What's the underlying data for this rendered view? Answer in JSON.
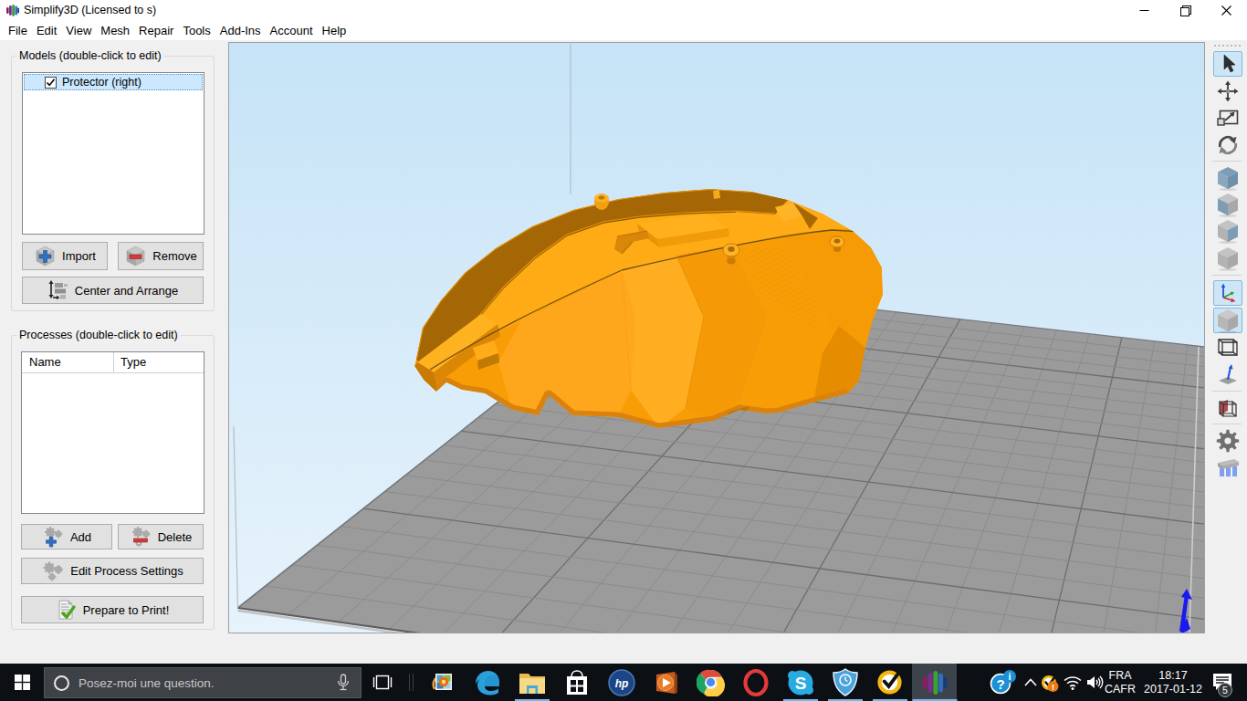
{
  "window": {
    "title": "Simplify3D (Licensed to s)",
    "controls": [
      "minimize",
      "maximize",
      "close"
    ]
  },
  "menu": {
    "items": [
      "File",
      "Edit",
      "View",
      "Mesh",
      "Repair",
      "Tools",
      "Add-Ins",
      "Account",
      "Help"
    ]
  },
  "left_panel": {
    "models_group": {
      "label": "Models (double-click to edit)",
      "list": [
        {
          "label": "Protector (right)",
          "checked": true,
          "selected": true
        }
      ],
      "buttons": {
        "import": "Import",
        "remove": "Remove",
        "center_arrange": "Center and Arrange"
      }
    },
    "processes_group": {
      "label": "Processes (double-click to edit)",
      "table": {
        "columns": [
          "Name",
          "Type"
        ],
        "rows": []
      },
      "buttons": {
        "add": "Add",
        "delete": "Delete",
        "edit_process_settings": "Edit Process Settings",
        "prepare_to_print": "Prepare to Print!"
      }
    }
  },
  "viewport": {
    "colors": {
      "sky_top": "#c6e3f7",
      "sky_bottom": "#e7f3fb",
      "plate": "#9b9b9b",
      "grid_minor": "#8b8b8b",
      "grid_major": "#6e6e6e",
      "plate_edge_front": "#5e5e5e",
      "plate_edge_back": "#75797d",
      "volume_line": "#b5babf",
      "model_base": "#f89d05",
      "model_dark_rim": "#a56605",
      "model_plateau": "#ffab15",
      "model_bright": "#ffa71c",
      "model_bright2": "#ffae22",
      "model_right": "#f69a06",
      "model_right_dark": "#e68c00",
      "model_bottom_band": "#d9820d",
      "model_seam": "#6e5210",
      "axis_z": "#1a1af0"
    }
  },
  "right_toolbar": {
    "items": [
      {
        "name": "select",
        "selected": true
      },
      {
        "name": "move",
        "selected": false
      },
      {
        "name": "scale",
        "selected": false
      },
      {
        "name": "rotate",
        "selected": false
      },
      {
        "name": "view-default",
        "selected": false
      },
      {
        "name": "view-top",
        "selected": false
      },
      {
        "name": "view-front",
        "selected": false
      },
      {
        "name": "view-side",
        "selected": false
      },
      {
        "name": "show-axes",
        "selected": true
      },
      {
        "name": "solid-render",
        "selected": true
      },
      {
        "name": "wireframe",
        "selected": false
      },
      {
        "name": "normals",
        "selected": false
      },
      {
        "name": "cross-section",
        "selected": false
      },
      {
        "name": "machine-settings",
        "selected": false
      },
      {
        "name": "support-structures",
        "selected": false
      }
    ]
  },
  "taskbar": {
    "search": {
      "placeholder": "Posez-moi une question."
    },
    "apps": [
      {
        "name": "photos",
        "running": false,
        "focused": false
      },
      {
        "name": "edge",
        "running": false,
        "focused": false
      },
      {
        "name": "file-explorer",
        "running": true,
        "focused": false
      },
      {
        "name": "store",
        "running": false,
        "focused": false
      },
      {
        "name": "hp",
        "running": false,
        "focused": false
      },
      {
        "name": "media-player",
        "running": false,
        "focused": false
      },
      {
        "name": "chrome",
        "running": false,
        "focused": false
      },
      {
        "name": "opera",
        "running": false,
        "focused": false
      },
      {
        "name": "skype",
        "running": true,
        "focused": false
      },
      {
        "name": "security-shield",
        "running": true,
        "focused": false
      },
      {
        "name": "norton",
        "running": true,
        "focused": false
      },
      {
        "name": "simplify3d",
        "running": true,
        "focused": true
      }
    ],
    "tray": {
      "language_line1": "FRA",
      "language_line2": "CAFR",
      "time": "18:17",
      "date": "2017-01-12",
      "notification_count": "5"
    }
  }
}
